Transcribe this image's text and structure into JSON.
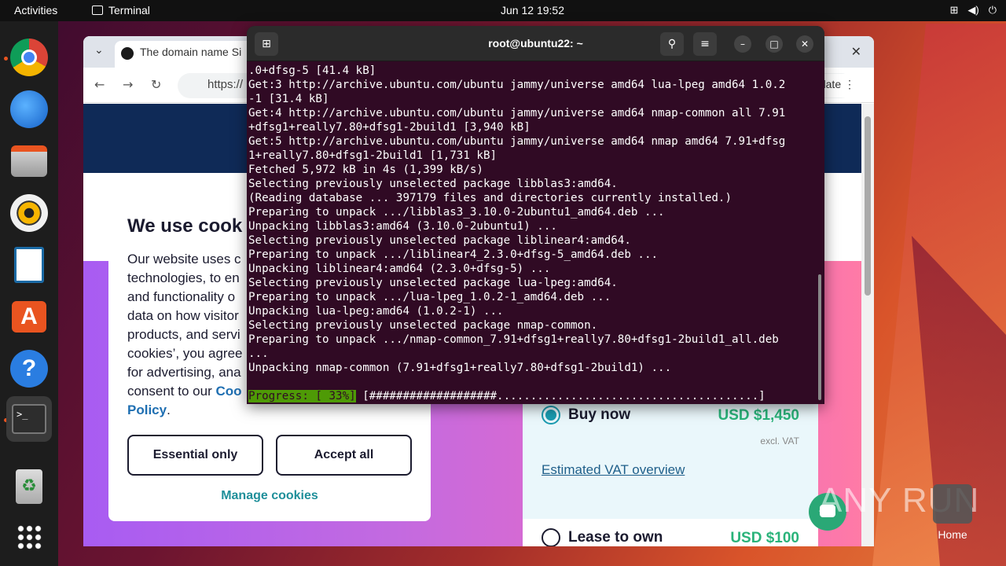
{
  "topbar": {
    "activities": "Activities",
    "app_name": "Terminal",
    "clock": "Jun 12  19:52"
  },
  "dock": {
    "items": [
      {
        "name": "chrome"
      },
      {
        "name": "thunderbird"
      },
      {
        "name": "files"
      },
      {
        "name": "rhythmbox"
      },
      {
        "name": "writer"
      },
      {
        "name": "app-center"
      },
      {
        "name": "help"
      },
      {
        "name": "terminal"
      },
      {
        "name": "trash"
      },
      {
        "name": "show-apps"
      }
    ]
  },
  "browser": {
    "tab_title": "The domain name Si",
    "url": "https://",
    "update_label": "date",
    "cookie": {
      "title": "We use cook",
      "text_lines": [
        "Our website uses c",
        "technologies, to en",
        "and functionality o",
        "data on how visitor",
        "products, and servi",
        "cookies’, you agree",
        "for advertising, ana",
        "consent to our "
      ],
      "link_a": "Coo",
      "link_b": "Policy",
      "essential_btn": "Essential only",
      "accept_btn": "Accept all",
      "manage_link": "Manage cookies"
    },
    "price": {
      "buy_now": "Buy now",
      "buy_amount": "USD $1,450",
      "vat_note": "excl. VAT",
      "vat_link": "Estimated VAT overview",
      "lease": "Lease to own",
      "lease_amount": "USD $100"
    }
  },
  "terminal": {
    "title": "root@ubuntu22: ~",
    "output": ".0+dfsg-5 [41.4 kB]\nGet:3 http://archive.ubuntu.com/ubuntu jammy/universe amd64 lua-lpeg amd64 1.0.2\n-1 [31.4 kB]\nGet:4 http://archive.ubuntu.com/ubuntu jammy/universe amd64 nmap-common all 7.91\n+dfsg1+really7.80+dfsg1-2build1 [3,940 kB]\nGet:5 http://archive.ubuntu.com/ubuntu jammy/universe amd64 nmap amd64 7.91+dfsg\n1+really7.80+dfsg1-2build1 [1,731 kB]\nFetched 5,972 kB in 4s (1,399 kB/s)\nSelecting previously unselected package libblas3:amd64.\n(Reading database ... 397179 files and directories currently installed.)\nPreparing to unpack .../libblas3_3.10.0-2ubuntu1_amd64.deb ...\nUnpacking libblas3:amd64 (3.10.0-2ubuntu1) ...\nSelecting previously unselected package liblinear4:amd64.\nPreparing to unpack .../liblinear4_2.3.0+dfsg-5_amd64.deb ...\nUnpacking liblinear4:amd64 (2.3.0+dfsg-5) ...\nSelecting previously unselected package lua-lpeg:amd64.\nPreparing to unpack .../lua-lpeg_1.0.2-1_amd64.deb ...\nUnpacking lua-lpeg:amd64 (1.0.2-1) ...\nSelecting previously unselected package nmap-common.\nPreparing to unpack .../nmap-common_7.91+dfsg1+really7.80+dfsg1-2build1_all.deb\n...\nUnpacking nmap-common (7.91+dfsg1+really7.80+dfsg1-2build1) ...",
    "progress_label": "Progress: [ 33%]",
    "progress_bar": " [###################.......................................]"
  },
  "overlay": {
    "watermark": "ANY RUN",
    "home_label": "Home"
  }
}
